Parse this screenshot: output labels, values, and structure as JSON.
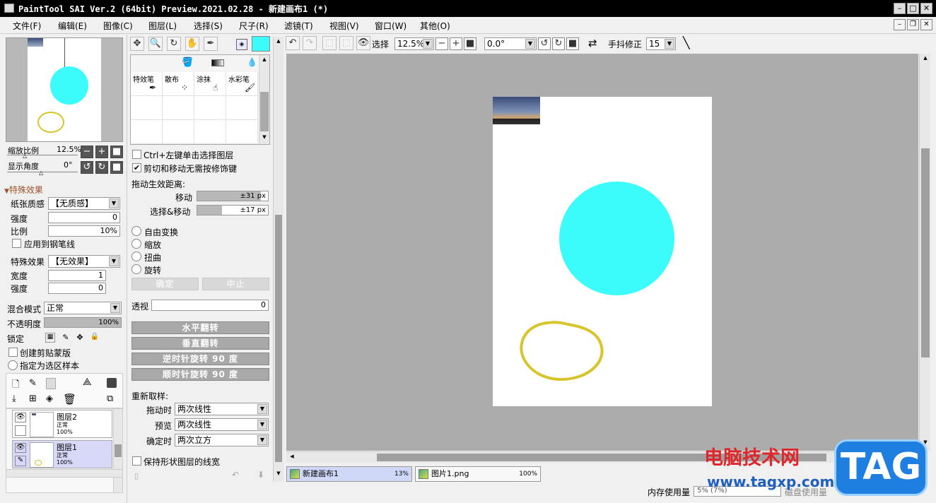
{
  "window": {
    "title": "PaintTool SAI Ver.2 (64bit) Preview.2021.02.28 - 新建画布1 (*)"
  },
  "menu": [
    "文件(F)",
    "编辑(E)",
    "图像(C)",
    "图层(L)",
    "选择(S)",
    "尺子(R)",
    "滤镜(T)",
    "视图(V)",
    "窗口(W)",
    "其他(O)"
  ],
  "navigator": {
    "zoom_label": "缩放比例",
    "zoom_value": "12.5%",
    "angle_label": "显示角度",
    "angle_value": "0°"
  },
  "effects": {
    "section_title": "特殊效果",
    "paper_label": "纸张质感",
    "paper_value": "【无质感】",
    "strength_label": "强度",
    "strength_value": "0",
    "scale_label": "比例",
    "scale_value": "10%",
    "apply_pen_label": "应用到钢笔线",
    "effect_label": "特殊效果",
    "effect_value": "【无效果】",
    "width_label": "宽度",
    "width_value": "1",
    "strength2_label": "强度",
    "strength2_value": "0"
  },
  "layer_props": {
    "blend_label": "混合模式",
    "blend_value": "正常",
    "opacity_label": "不透明度",
    "opacity_value": "100%",
    "opacity_fraction": 1.0,
    "lock_label": "锁定",
    "clip_label": "创建剪贴蒙版",
    "sel_sample_label": "指定为选区样本"
  },
  "layers": [
    {
      "name": "图层2",
      "mode": "正常",
      "opacity": "100%"
    },
    {
      "name": "图层1",
      "mode": "正常",
      "opacity": "100%"
    }
  ],
  "tools": {
    "brushes": [
      "特效笔",
      "散布",
      "涂抹",
      "水彩笔"
    ],
    "primary_color": "#3cfbfb"
  },
  "transform": {
    "ctrl_click_label": "Ctrl+左键单击选择图层",
    "cut_move_label": "剪切和移动无需按修饰键",
    "drag_dist_label": "拖动生效距离:",
    "move_label": "移动",
    "move_value": "±31 px",
    "move_fraction": 0.9,
    "sel_move_label": "选择&移动",
    "sel_move_value": "±17 px",
    "sel_move_fraction": 0.35,
    "modes": [
      "自由变换",
      "缩放",
      "扭曲",
      "旋转"
    ],
    "ok_label": "确定",
    "cancel_label": "中止",
    "perspective_label": "透视",
    "perspective_value": "0",
    "flip_h": "水平翻转",
    "flip_v": "垂直翻转",
    "rot_ccw": "逆时针旋转 90 度",
    "rot_cw": "顺时针旋转 90 度",
    "resample_label": "重新取样:",
    "drag_time_label": "拖动时",
    "drag_time_value": "两次线性",
    "preview_label": "预览",
    "preview_value": "两次线性",
    "confirm_label": "确定时",
    "confirm_value": "两次立方",
    "keep_shape_label": "保持形状图层的线宽"
  },
  "canvas_toolbar": {
    "select_label": "选择",
    "zoom_value": "12.5%",
    "angle_value": "0.0°",
    "stabilizer_label": "手抖修正",
    "stabilizer_value": "15"
  },
  "canvas": {
    "circle_color": "#3cfbfb",
    "stroke_color": "#d8c42c",
    "bg_color": "#acacac"
  },
  "tabs": [
    {
      "name": "新建画布1",
      "zoom": "13%"
    },
    {
      "name": "图片1.png",
      "zoom": "100%"
    }
  ],
  "status": {
    "memory_label": "内存使用量",
    "memory_value": "5% (7%)",
    "disk_label": "磁盘使用量"
  },
  "watermark": {
    "site": "电脑技术网",
    "url": "www.tagxp.com",
    "logo": "TAG"
  }
}
